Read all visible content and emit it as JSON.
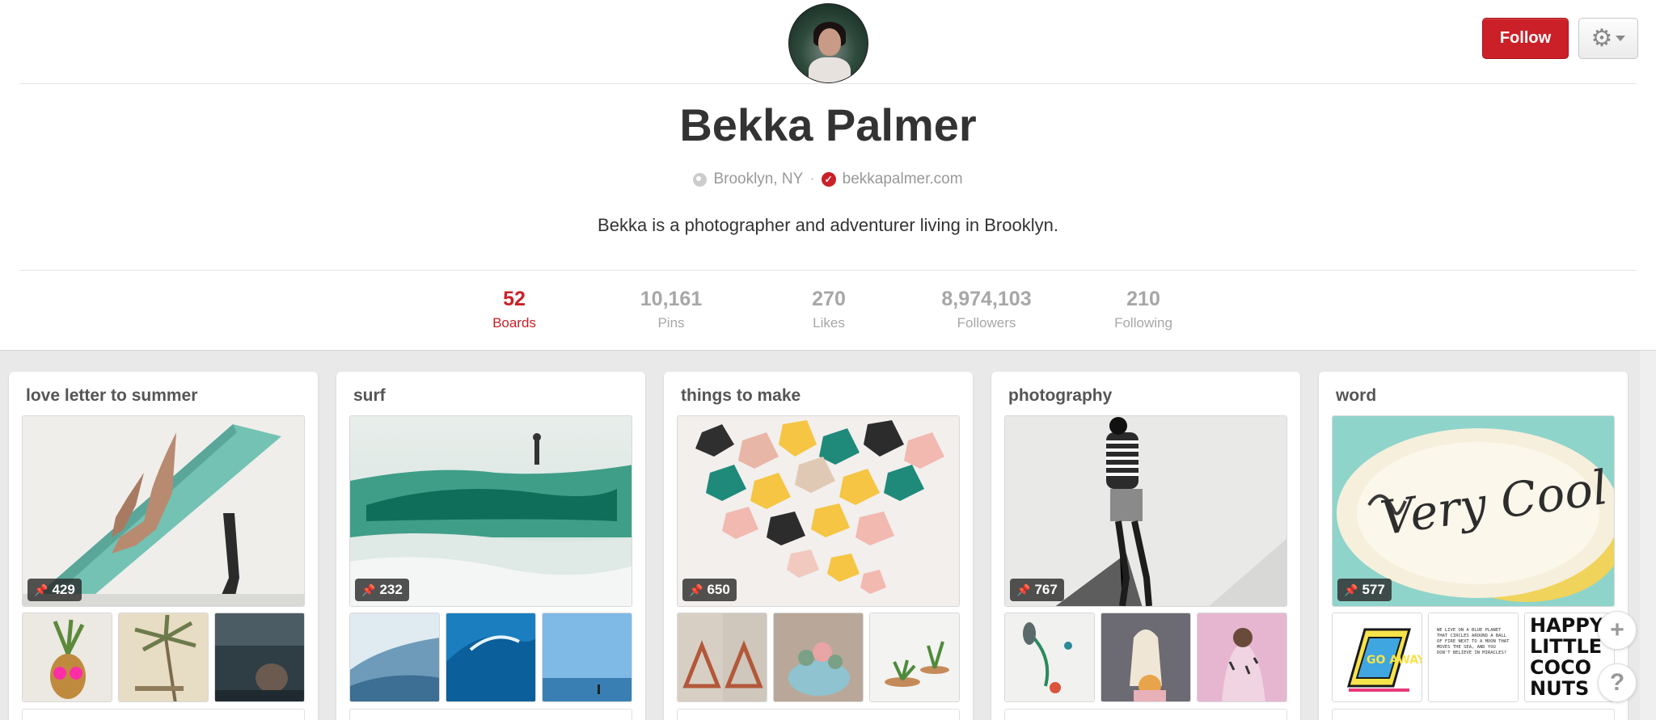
{
  "profile": {
    "name": "Bekka Palmer",
    "location": "Brooklyn, NY",
    "website": "bekkapalmer.com",
    "separator": "·",
    "bio": "Bekka is a photographer and adventurer living in Brooklyn."
  },
  "actions": {
    "follow_label": "Follow",
    "settings_icon": "gear-icon"
  },
  "stats": [
    {
      "num": "52",
      "label": "Boards",
      "active": true
    },
    {
      "num": "10,161",
      "label": "Pins",
      "active": false
    },
    {
      "num": "270",
      "label": "Likes",
      "active": false
    },
    {
      "num": "8,974,103",
      "label": "Followers",
      "active": false
    },
    {
      "num": "210",
      "label": "Following",
      "active": false
    }
  ],
  "boards": [
    {
      "title": "love letter to summer",
      "pin_count": "429"
    },
    {
      "title": "surf",
      "pin_count": "232"
    },
    {
      "title": "things to make",
      "pin_count": "650"
    },
    {
      "title": "photography",
      "pin_count": "767"
    },
    {
      "title": "word",
      "pin_count": "577"
    }
  ],
  "word_thumbs": {
    "sign_text": "GO AWAY",
    "note_text": "WE LIVE ON A BLUE PLANET THAT CIRCLES AROUND A BALL OF FIRE NEXT TO A MOON THAT MOVES THE SEA, AND YOU DON'T BELIEVE IN MIRACLES?",
    "coconuts_text": "HAPPY LITTLE COCO NUTS"
  },
  "floating": {
    "add_icon": "plus-icon",
    "help_icon": "question-icon"
  },
  "colors": {
    "accent": "#cb2027",
    "muted": "#a7a7a7"
  }
}
